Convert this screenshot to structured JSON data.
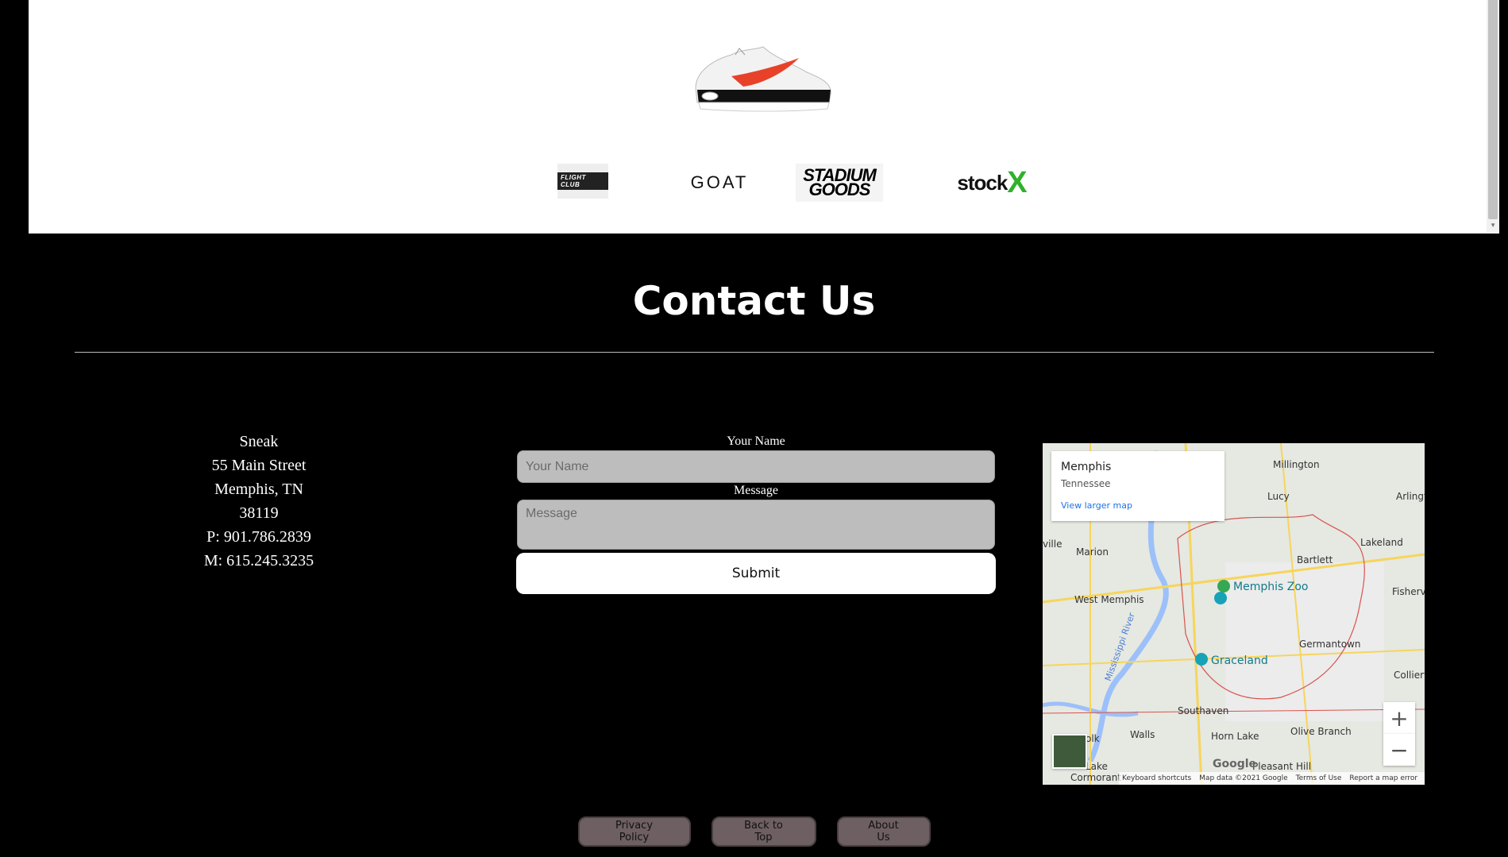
{
  "brands": {
    "flight_club": "FLIGHT CLUB",
    "goat": "GOAT",
    "stadium_line1": "STADIUM",
    "stadium_line2": "GOODS",
    "stockx_text": "stock",
    "stockx_mark": "X"
  },
  "contact": {
    "title": "Contact Us",
    "address_lines": [
      "Sneak",
      "55 Main Street",
      "Memphis, TN",
      "38119",
      "P: 901.786.2839",
      "M: 615.245.3235"
    ],
    "form": {
      "name_label": "Your Name",
      "name_placeholder": "Your Name",
      "message_label": "Message",
      "message_placeholder": "Message",
      "submit_label": "Submit"
    }
  },
  "map": {
    "card_title": "Memphis",
    "card_subtitle": "Tennessee",
    "card_link": "View larger map",
    "labels": [
      "Millington",
      "Lucy",
      "Arlingto",
      "Marion",
      "Bartlett",
      "Lakeland",
      "West Memphis",
      "Fisherv",
      "Germantown",
      "Collierv",
      "Southaven",
      "Olive Branch",
      "Walls",
      "Horn Lake",
      "Pleasant Hill",
      "ville",
      "Mississippi River",
      "olk",
      "Lake",
      "Cormorant"
    ],
    "poi_zoo": "Memphis Zoo",
    "poi_graceland": "Graceland",
    "zoom_in": "+",
    "zoom_out": "−",
    "logo": "Google",
    "footer": [
      "Keyboard shortcuts",
      "Map data ©2021 Google",
      "Terms of Use",
      "Report a map error"
    ],
    "colors": {
      "land": "#e6e8e2",
      "water": "#9cc0f9",
      "highway": "#f6d55c",
      "boundary": "#d9534f"
    }
  },
  "footer_buttons": {
    "privacy": "Privacy Policy",
    "back_to_top": "Back to Top",
    "about": "About Us"
  }
}
